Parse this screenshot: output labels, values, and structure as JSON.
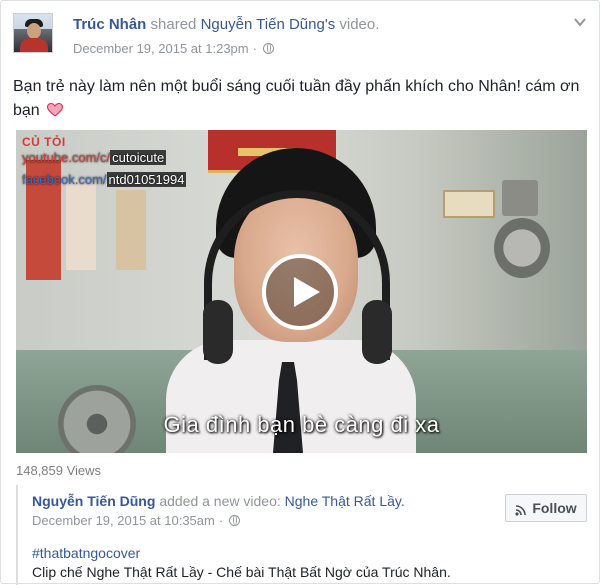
{
  "post": {
    "author": "Trúc Nhân",
    "action": "shared",
    "shared_owner": "Nguyễn Tiến Dũng's",
    "shared_type": "video.",
    "timestamp": "December 19, 2015 at 1:23pm",
    "separator": "·",
    "privacy_icon": "globe-icon",
    "menu_icon": "chevron-down-icon",
    "text": "Bạn trẻ này làm nên một buổi sáng cuối tuần đầy phấn khích cho Nhân! cám ơn bạn",
    "emoji_icon": "heart-icon"
  },
  "video": {
    "watermark_title": "CỦ TỎI",
    "watermark_youtube_prefix": "youtube.com/c/",
    "watermark_youtube_name": "cutoicute",
    "watermark_facebook_prefix": "facebook.com/",
    "watermark_facebook_name": "ntd01051994",
    "subtitle": "Gia đình bạn bè càng đi xa",
    "play_icon": "play-icon",
    "views": "148,859 Views"
  },
  "shared_post": {
    "author": "Nguyễn Tiến Dũng",
    "action": "added a new video:",
    "video_title": "Nghe Thật Rất Lầy.",
    "timestamp": "December 19, 2015 at 10:35am",
    "separator": "·",
    "privacy_icon": "globe-icon",
    "follow_label": "Follow",
    "follow_icon": "rss-icon",
    "hashtag": "#thatbatngocover",
    "description": "Clip chế Nghe Thật Rất Lầy - Chế bài Thật Bất Ngờ của Trúc Nhân."
  },
  "colors": {
    "link": "#365899",
    "meta": "#90949c",
    "text": "#1d2129",
    "heart": "#e0245e"
  }
}
